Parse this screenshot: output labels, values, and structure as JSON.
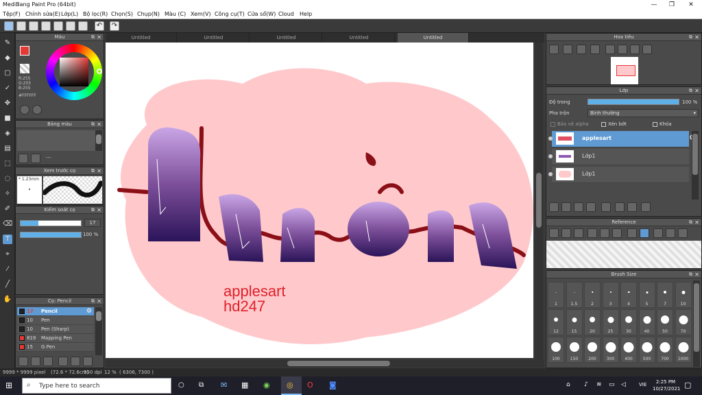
{
  "window": {
    "title": "MediBang Paint Pro (64bit)"
  },
  "menu": [
    "Tệp(F)",
    "Chỉnh sửa(E)",
    "Lớp(L)",
    "Bộ lọc(R)",
    "Chọn(S)",
    "Chụp(N)",
    "Màu (C)",
    "Xem(V)",
    "Công cụ(T)",
    "Cửa sổ(W)",
    "Cloud",
    "Help"
  ],
  "tabs": [
    "Untitled",
    "Untitled",
    "Untitled",
    "Untitled",
    "Untitled"
  ],
  "color_panel": {
    "title": "Màu",
    "r": "R:255",
    "g": "G:255",
    "b": "B:255",
    "hex": "#FFFFFF",
    "accent": "#e53935"
  },
  "palette_panel": {
    "title": "Bảng màu",
    "dash": "---"
  },
  "brush_preview": {
    "title": "Xem trước cọ",
    "size": "* 1.23mm"
  },
  "brush_control": {
    "title": "Kiểm soát cọ",
    "size_value": "17",
    "opacity_value": "100 %",
    "size_fraction": 0.3,
    "opacity_fraction": 1.0
  },
  "brush_list": {
    "title": "Cọ: Pencil",
    "items": [
      {
        "num": "17",
        "name": "Pencil",
        "color": "#222"
      },
      {
        "num": "10",
        "name": "Pen",
        "color": "#222"
      },
      {
        "num": "10",
        "name": "Pen (Sharp)",
        "color": "#222"
      },
      {
        "num": "819",
        "name": "Mapping Pen",
        "color": "#e53935"
      },
      {
        "num": "15",
        "name": "G Pen",
        "color": "#e53935"
      }
    ]
  },
  "navigator": {
    "title": "Hoa tiêu"
  },
  "layers_panel": {
    "title": "Lớp",
    "opacity_label": "Độ trong",
    "opacity_value": "100 %",
    "blend_label": "Pha trộn",
    "blend_value": "Bình thường",
    "protect_alpha": "Bảo vệ alpha",
    "clipping": "Xén bớt",
    "lock": "Khóa",
    "layers": [
      {
        "name": "applesart",
        "selected": true
      },
      {
        "name": "Lớp1",
        "selected": false
      },
      {
        "name": "Lớp1",
        "selected": false
      }
    ]
  },
  "reference": {
    "title": "Reference"
  },
  "brush_size": {
    "title": "Brush Size",
    "sizes": [
      "1",
      "1.5",
      "2",
      "3",
      "4",
      "5",
      "7",
      "10",
      "12",
      "15",
      "20",
      "25",
      "30",
      "40",
      "50",
      "70",
      "100",
      "150",
      "200",
      "300",
      "400",
      "500",
      "700",
      "1000"
    ]
  },
  "canvas": {
    "signature_line1": "applesart",
    "signature_line2": "hd247",
    "text_color": "#e0202a",
    "blob_color": "#ffc9cc"
  },
  "status": {
    "size": "9999 * 9999 pixel",
    "physical": "(72.6 * 72.6cm)",
    "dpi": "350 dpi",
    "zoom": "12 %",
    "coords": "( 6306, 7300 )"
  },
  "taskbar": {
    "search": "Type here to search",
    "time": "2:25 PM",
    "date": "10/27/2021",
    "lang": "VIE"
  }
}
